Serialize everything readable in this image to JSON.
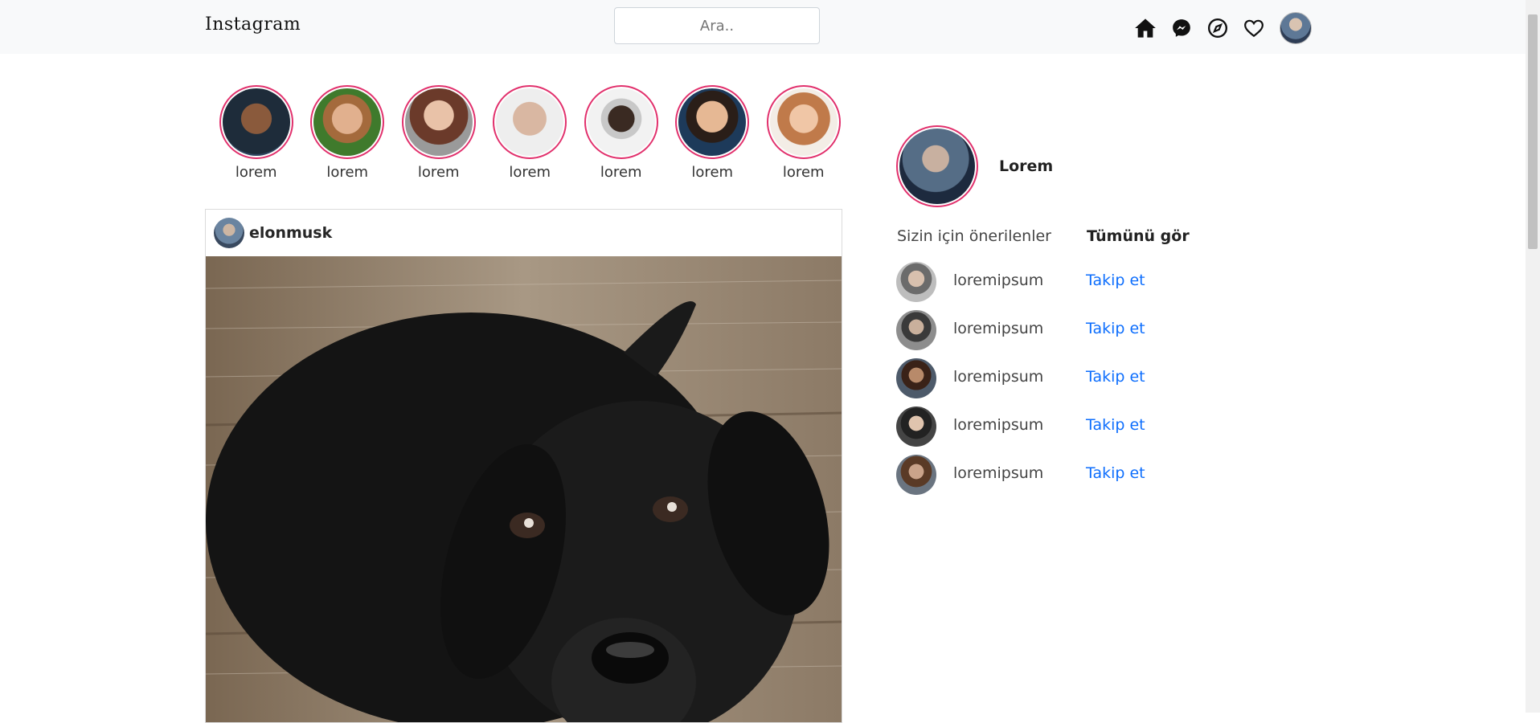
{
  "nav": {
    "logo": "Instagram",
    "search_placeholder": "Ara.."
  },
  "stories": [
    {
      "label": "lorem"
    },
    {
      "label": "lorem"
    },
    {
      "label": "lorem"
    },
    {
      "label": "lorem"
    },
    {
      "label": "lorem"
    },
    {
      "label": "lorem"
    },
    {
      "label": "lorem"
    }
  ],
  "post": {
    "username": "elonmusk"
  },
  "profile": {
    "name": "Lorem"
  },
  "suggestions": {
    "title": "Sizin için önerilenler",
    "see_all": "Tümünü gör",
    "items": [
      {
        "name": "loremipsum",
        "action": "Takip et"
      },
      {
        "name": "loremipsum",
        "action": "Takip et"
      },
      {
        "name": "loremipsum",
        "action": "Takip et"
      },
      {
        "name": "loremipsum",
        "action": "Takip et"
      },
      {
        "name": "loremipsum",
        "action": "Takip et"
      }
    ]
  },
  "colors": {
    "story_ring": "#e1306c",
    "link": "#0d6efd",
    "navbar_bg": "#f8f9fa"
  }
}
